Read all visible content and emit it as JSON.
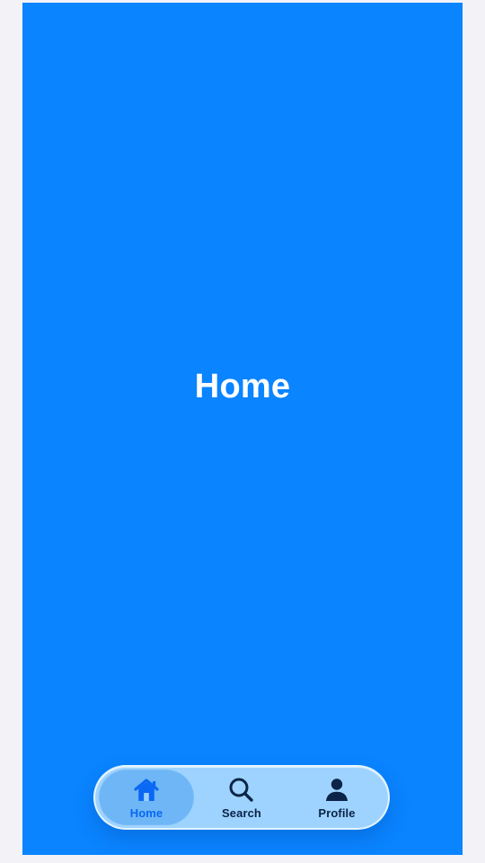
{
  "screen": {
    "title": "Home",
    "background_color": "#0a84ff"
  },
  "tabbar": {
    "active_color": "#0a68f5",
    "inactive_color": "#0b2447",
    "tabs": [
      {
        "label": "Home",
        "icon": "home-icon",
        "active": true
      },
      {
        "label": "Search",
        "icon": "search-icon",
        "active": false
      },
      {
        "label": "Profile",
        "icon": "person-icon",
        "active": false
      }
    ]
  }
}
